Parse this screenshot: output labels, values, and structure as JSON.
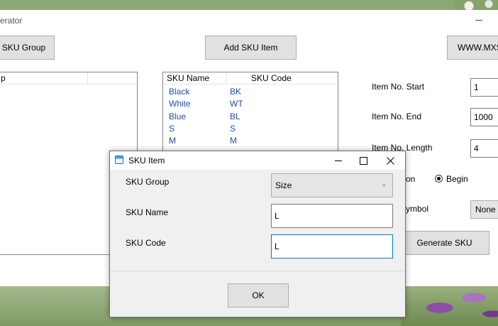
{
  "main": {
    "title_fragment": "erator",
    "buttons": {
      "sku_group": "SKU Group",
      "add_sku_item": "Add SKU Item",
      "website": "WWW.MXS",
      "generate_sku": "Generate SKU"
    },
    "group_list": {
      "header": "p"
    },
    "sku_list": {
      "columns": [
        "SKU Name",
        "SKU Code"
      ],
      "rows": [
        {
          "name": "Black",
          "code": "BK"
        },
        {
          "name": "White",
          "code": "WT"
        },
        {
          "name": "Blue",
          "code": "BL"
        },
        {
          "name": "S",
          "code": "S"
        },
        {
          "name": "M",
          "code": "M"
        }
      ]
    },
    "fields": {
      "item_no_start_label": "Item No. Start",
      "item_no_start_value": "1",
      "item_no_end_label": "Item No. End",
      "item_no_end_value": "1000",
      "item_no_length_label": "Item No. Length",
      "item_no_length_value": "4",
      "position_label_fragment": "on",
      "position_begin_label": "Begin",
      "symbol_label_fragment": "ymbol",
      "symbol_value": "None"
    }
  },
  "dialog": {
    "title": "SKU Item",
    "sku_group_label": "SKU Group",
    "sku_group_value": "Size",
    "sku_name_label": "SKU Name",
    "sku_name_value": "L",
    "sku_code_label": "SKU Code",
    "sku_code_value": "L",
    "ok_label": "OK"
  }
}
